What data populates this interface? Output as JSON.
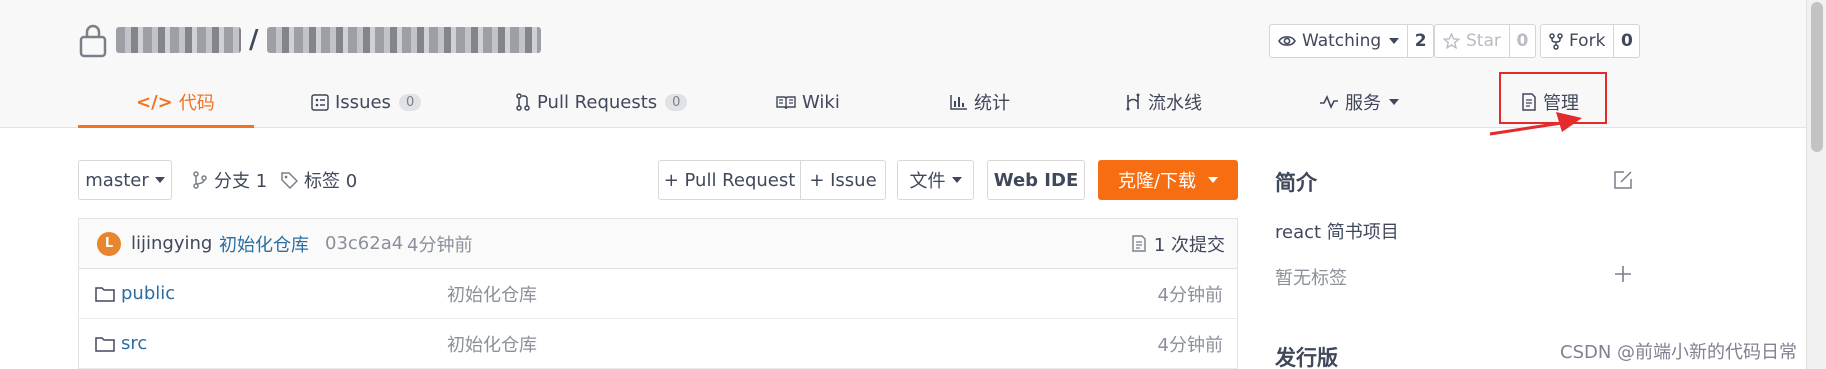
{
  "repo": {
    "separator": "/"
  },
  "header_actions": {
    "watch": {
      "label": "Watching",
      "count": "2"
    },
    "star": {
      "label": "Star",
      "count": "0"
    },
    "fork": {
      "label": "Fork",
      "count": "0"
    }
  },
  "tabs": [
    {
      "label": "代码",
      "icon": "code-icon",
      "badge": ""
    },
    {
      "label": "Issues",
      "icon": "issues-icon",
      "badge": "0"
    },
    {
      "label": "Pull Requests",
      "icon": "pull-request-icon",
      "badge": "0"
    },
    {
      "label": "Wiki",
      "icon": "book-icon",
      "badge": ""
    },
    {
      "label": "统计",
      "icon": "chart-icon",
      "badge": ""
    },
    {
      "label": "流水线",
      "icon": "pipeline-icon",
      "badge": ""
    },
    {
      "label": "服务",
      "icon": "pulse-icon",
      "badge": ""
    },
    {
      "label": "管理",
      "icon": "document-icon",
      "badge": ""
    }
  ],
  "toolbar": {
    "branch": "master",
    "branches": "分支 1",
    "tags": "标签 0",
    "pull_request": "+ Pull Request",
    "issue": "+ Issue",
    "file_menu": "文件",
    "web_ide": "Web IDE",
    "clone": "克隆/下载"
  },
  "commit": {
    "avatar": "L",
    "author": "lijingying",
    "message": "初始化仓库",
    "hash": "03c62a4",
    "time": "4分钟前",
    "commits": "1 次提交"
  },
  "files": [
    {
      "name": "public",
      "message": "初始化仓库",
      "time": "4分钟前"
    },
    {
      "name": "src",
      "message": "初始化仓库",
      "time": "4分钟前"
    }
  ],
  "sidebar": {
    "intro_title": "简介",
    "description": "react 简书项目",
    "no_tags": "暂无标签",
    "release_title": "发行版"
  },
  "watermark": "CSDN @前端小新的代码日常",
  "colors": {
    "accent": "#f4721f",
    "clone_button": "#f76d12",
    "annotation": "#e42a2a",
    "link": "#2c6ea0"
  }
}
